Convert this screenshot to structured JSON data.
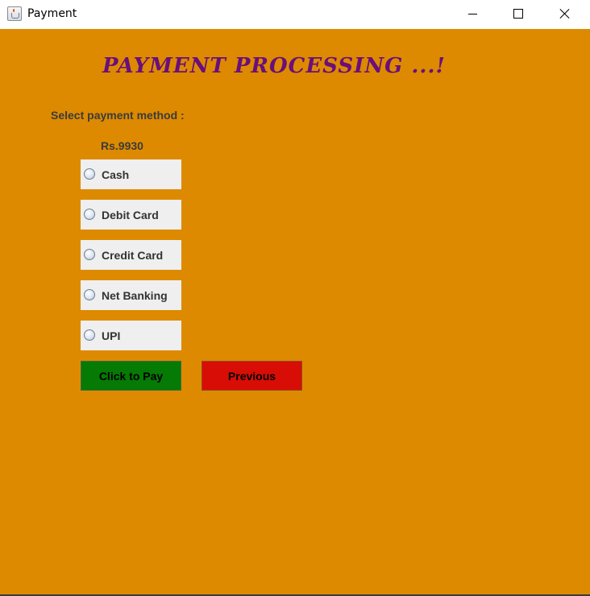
{
  "window": {
    "title": "Payment",
    "icon": "java-cup-icon"
  },
  "colors": {
    "background": "#dd8a00",
    "heading": "#6a0f7a",
    "pay_button": "#057a05",
    "previous_button": "#d80d05",
    "option_bg": "#efefef"
  },
  "main": {
    "heading": "PAYMENT PROCESSING ...!",
    "select_label": "Select payment method :",
    "amount": "Rs.9930",
    "options": [
      {
        "label": "Cash",
        "selected": false
      },
      {
        "label": "Debit Card",
        "selected": false
      },
      {
        "label": "Credit Card",
        "selected": false
      },
      {
        "label": "Net Banking",
        "selected": false
      },
      {
        "label": "UPI",
        "selected": false
      }
    ],
    "pay_button": "Click to Pay",
    "previous_button": "Previous"
  }
}
